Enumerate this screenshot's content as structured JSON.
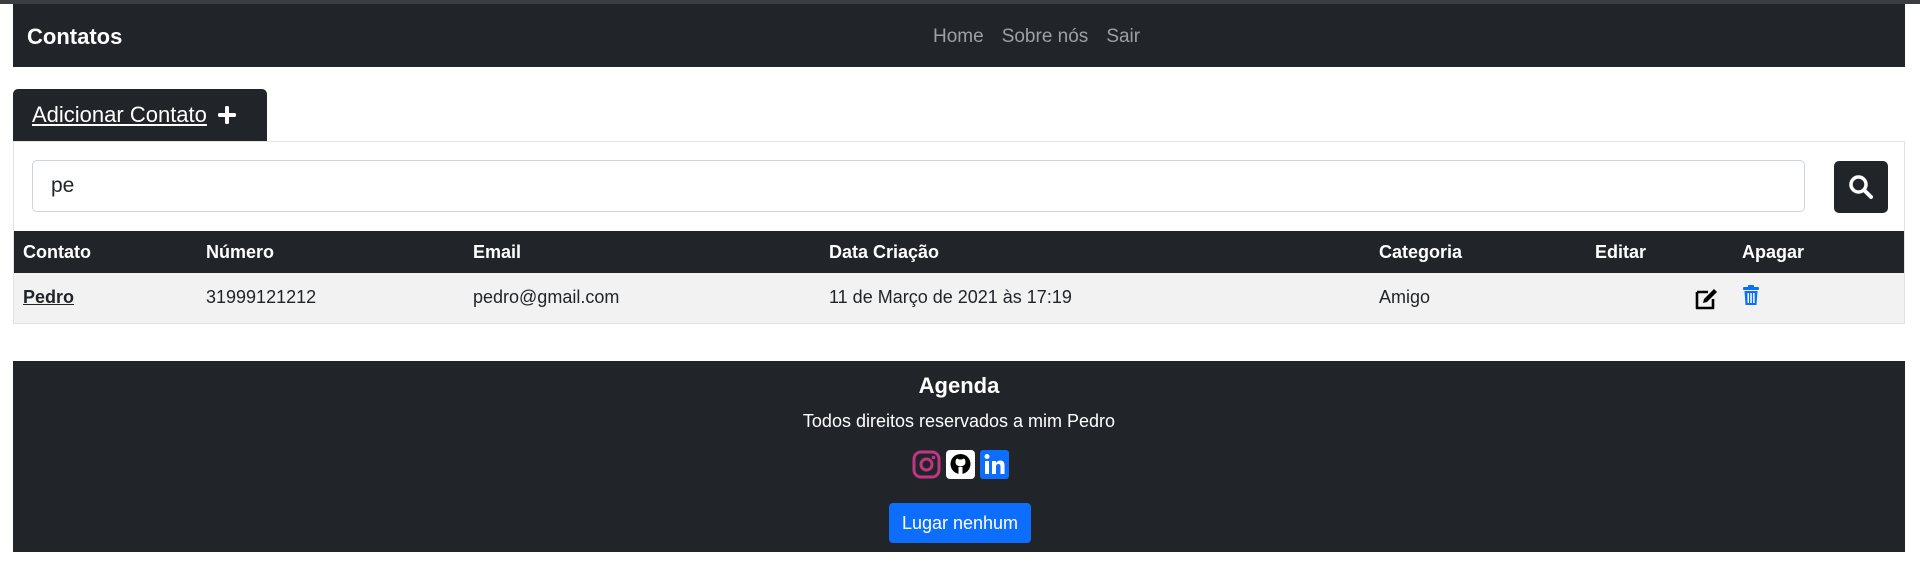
{
  "navbar": {
    "brand": "Contatos",
    "links": [
      "Home",
      "Sobre nós",
      "Sair"
    ]
  },
  "add_contact": {
    "label": "Adicionar Contato ",
    "icon": "plus-icon"
  },
  "search": {
    "value": "pe",
    "icon": "search-icon"
  },
  "table": {
    "headers": [
      "Contato",
      "Número",
      "Email",
      "Data Criação",
      "Categoria",
      "Editar",
      "Apagar"
    ],
    "rows": [
      {
        "contato": "Pedro",
        "numero": "31999121212",
        "email": "pedro@gmail.com",
        "data_criacao": "11 de Março de 2021 às 17:19",
        "categoria": "Amigo",
        "edit_icon": "edit-icon",
        "delete_icon": "trash-icon"
      }
    ]
  },
  "footer": {
    "title": "Agenda",
    "text": "Todos direitos reservados a mim Pedro",
    "socials": [
      "instagram-icon",
      "github-icon",
      "linkedin-icon"
    ],
    "button": "Lugar nenhum"
  },
  "colors": {
    "dark": "#212529",
    "primary": "#0d6efd",
    "instagram": "#c13584",
    "trash": "#0d6efd"
  }
}
